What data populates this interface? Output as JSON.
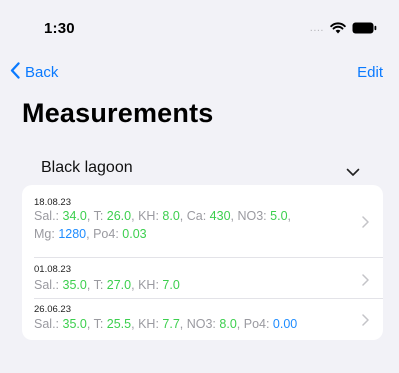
{
  "status_bar": {
    "time": "1:30",
    "signal": "....",
    "icons": [
      "wifi-icon",
      "battery-icon"
    ]
  },
  "nav": {
    "back_label": "Back",
    "edit_label": "Edit"
  },
  "title": "Measurements",
  "picker": {
    "selected": "Black lagoon"
  },
  "measurements": [
    {
      "date": "18.08.23",
      "values": [
        {
          "label": "Sal.: ",
          "value": "34.0"
        },
        {
          "label": "T: ",
          "value": "26.0"
        },
        {
          "label": "KH: ",
          "value": "8.0"
        },
        {
          "label": "Ca: ",
          "value": "430"
        },
        {
          "label": "NO3: ",
          "value": "5.0"
        },
        {
          "label": "Mg: ",
          "value": "1280"
        },
        {
          "label": "Po4: ",
          "value": "0.03"
        }
      ]
    },
    {
      "date": "01.08.23",
      "values": [
        {
          "label": "Sal.: ",
          "value": "35.0"
        },
        {
          "label": "T: ",
          "value": "27.0"
        },
        {
          "label": "KH: ",
          "value": "7.0"
        }
      ]
    },
    {
      "date": "26.06.23",
      "values": [
        {
          "label": "Sal.: ",
          "value": "35.0"
        },
        {
          "label": "T: ",
          "value": "25.5"
        },
        {
          "label": "KH: ",
          "value": "7.7"
        },
        {
          "label": "NO3: ",
          "value": "8.0"
        },
        {
          "label": "Po4: ",
          "value": "0.00"
        }
      ]
    }
  ],
  "colors": {
    "accent": "#0a7aff",
    "good": "#3ccf4e",
    "attention": "#1e8cff",
    "label": "#9a9aa0"
  }
}
